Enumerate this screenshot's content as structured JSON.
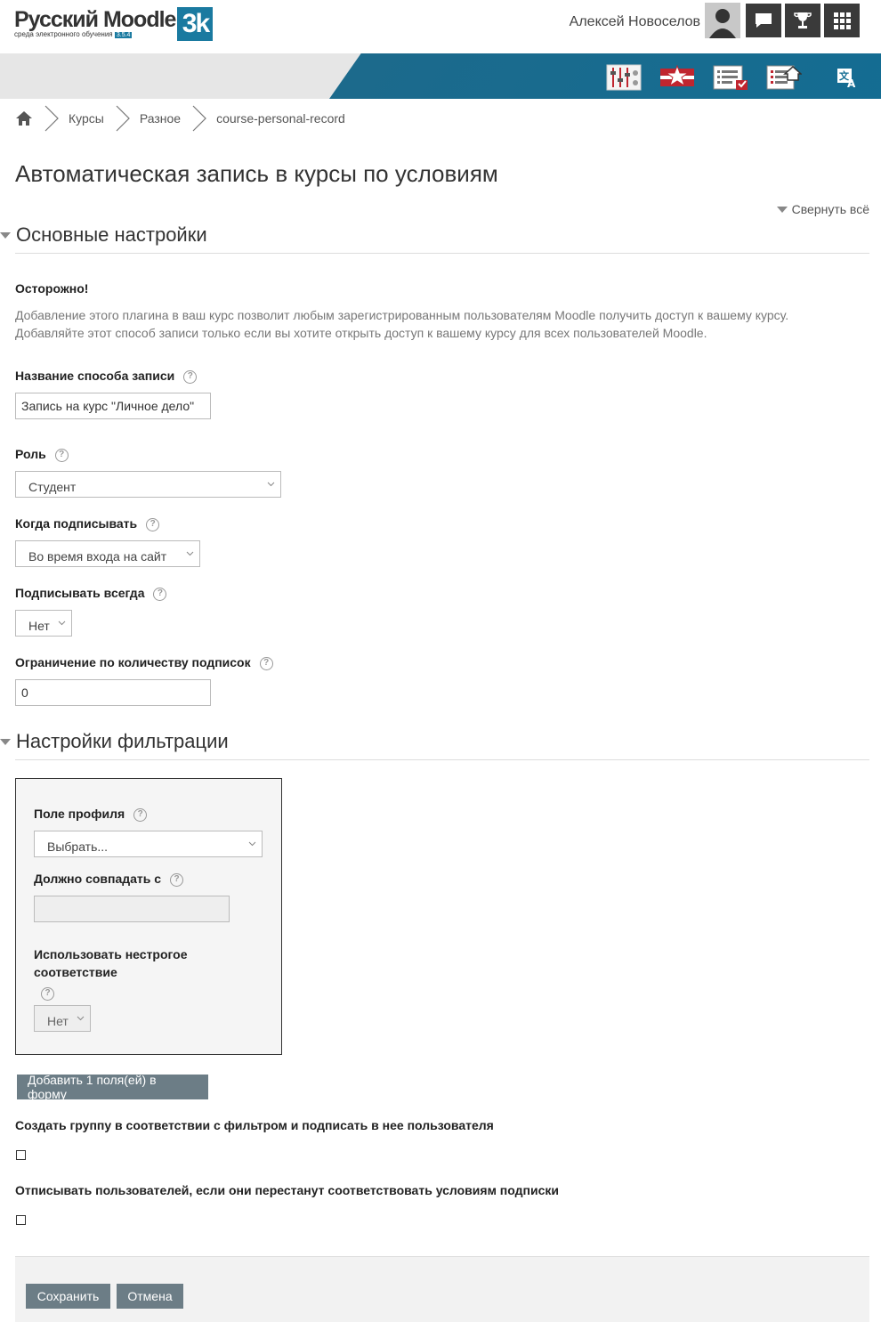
{
  "header": {
    "logo_main": "Русский Moodle",
    "logo_sub": "среда электронного обучения",
    "logo_version": "3.5.4",
    "logo_mark": "3k",
    "user_name": "Алексей Новоселов"
  },
  "breadcrumb": {
    "items": [
      "Курсы",
      "Разное",
      "course-personal-record"
    ]
  },
  "page": {
    "title": "Автоматическая запись в курсы по условиям",
    "collapse_all": "Свернуть всё"
  },
  "main_settings": {
    "heading": "Основные настройки",
    "warning_title": "Осторожно!",
    "warning_line1": "Добавление этого плагина в ваш курс позволит любым зарегистрированным пользователям Moodle получить доступ к вашему курсу.",
    "warning_line2": "Добавляйте этот способ записи только если вы хотите открыть доступ к вашему курсу для всех пользователей Moodle.",
    "name_label": "Название способа записи",
    "name_value": "Запись на курс \"Личное дело\"",
    "role_label": "Роль",
    "role_value": "Студент",
    "when_label": "Когда подписывать",
    "when_value": "Во время входа на сайт",
    "always_label": "Подписывать всегда",
    "always_value": "Нет",
    "limit_label": "Ограничение по количеству подписок",
    "limit_value": "0"
  },
  "filter_settings": {
    "heading": "Настройки фильтрации",
    "profile_field_label": "Поле профиля",
    "profile_field_value": "Выбрать...",
    "match_label": "Должно совпадать с",
    "match_value": "",
    "fuzzy_label_line1": "Использовать нестрогое",
    "fuzzy_label_line2": "соответствие",
    "fuzzy_value": "Нет",
    "add_fields_button": "Добавить 1 поля(ей) в форму",
    "create_group_label": "Создать группу в соответствии с фильтром и подписать в нее пользователя",
    "unenrol_label": "Отписывать пользователей, если они перестанут соответствовать условиям подписки"
  },
  "actions": {
    "save": "Сохранить",
    "cancel": "Отмена"
  },
  "colors": {
    "accent": "#1a7aa0",
    "button": "#6c7d86",
    "topbar_button": "#3a3a3a"
  },
  "icons": [
    "home-icon",
    "chat-icon",
    "trophy-icon",
    "grid-icon",
    "settings-sliders-icon",
    "star-badge-icon",
    "list-checked-icon",
    "list-home-icon",
    "translate-icon",
    "help-icon",
    "chevron-down-icon"
  ]
}
